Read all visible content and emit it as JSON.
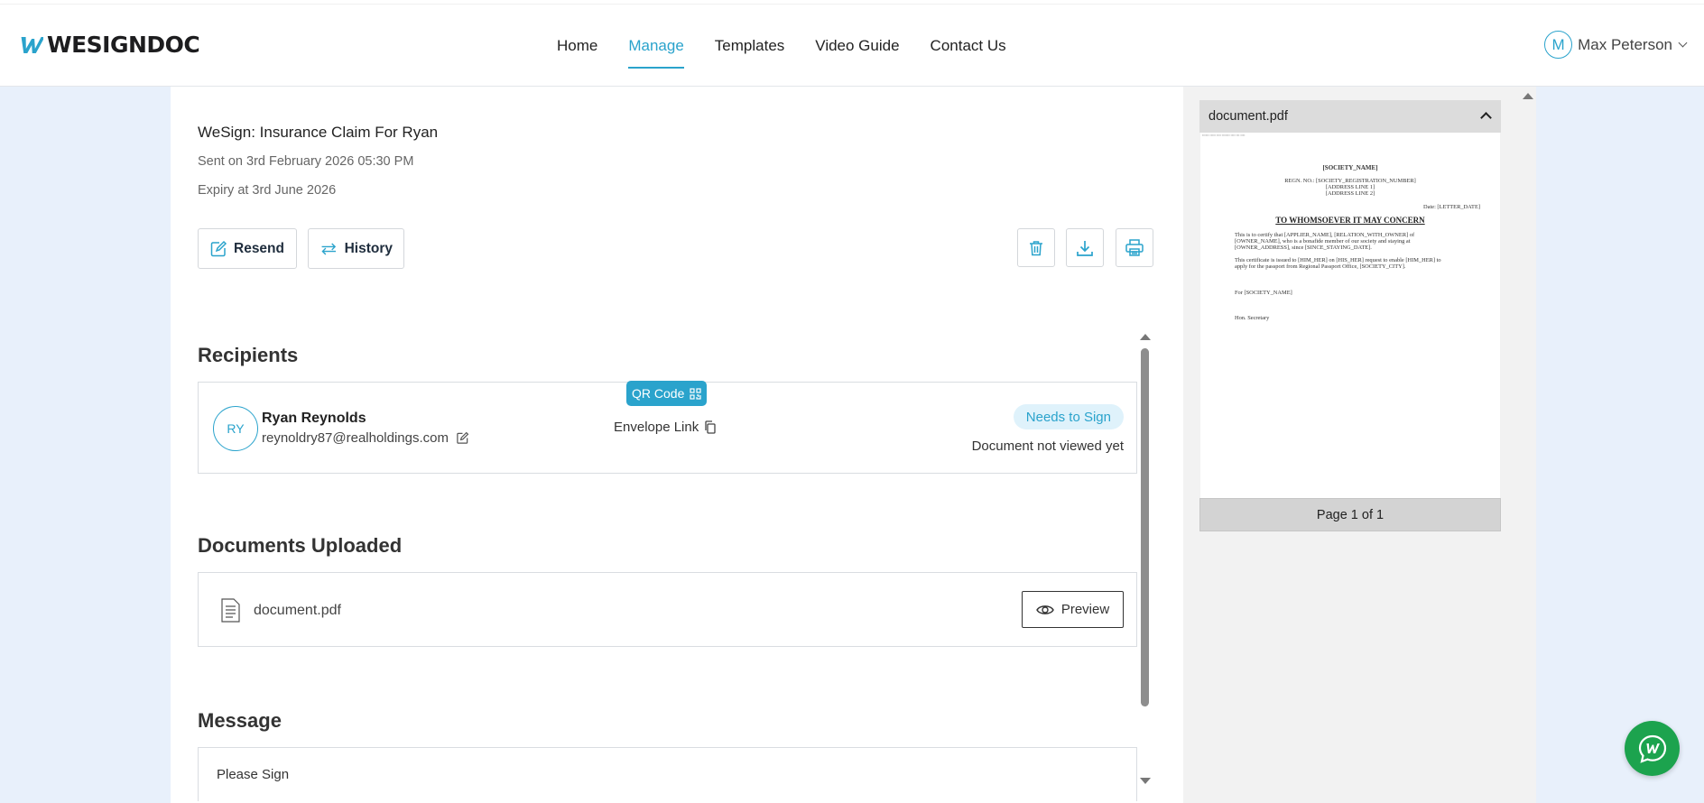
{
  "brand": {
    "logo_text": "WESIGNDOC",
    "accent": "#2aa3cc"
  },
  "nav": {
    "items": [
      {
        "label": "Home"
      },
      {
        "label": "Manage",
        "active": true
      },
      {
        "label": "Templates"
      },
      {
        "label": "Video Guide"
      },
      {
        "label": "Contact Us"
      }
    ]
  },
  "user": {
    "initial": "M",
    "name": "Max Peterson"
  },
  "envelope": {
    "title": "WeSign: Insurance Claim For Ryan",
    "sent": "Sent on 3rd February 2026 05:30 PM",
    "expiry": "Expiry at 3rd June 2026"
  },
  "actions": {
    "resend_label": "Resend",
    "history_label": "History"
  },
  "recipients": {
    "heading": "Recipients",
    "items": [
      {
        "initials": "RY",
        "name": "Ryan Reynolds",
        "email": "reynoldry87@realholdings.com",
        "qr_label": "QR Code",
        "envelope_link_label": "Envelope Link",
        "status": "Needs to Sign",
        "view_status": "Document not viewed yet"
      }
    ]
  },
  "documents": {
    "heading": "Documents Uploaded",
    "items": [
      {
        "name": "document.pdf",
        "preview_label": "Preview"
      }
    ]
  },
  "message": {
    "heading": "Message",
    "text": "Please Sign"
  },
  "pdf_preview": {
    "file_name": "document.pdf",
    "page_indicator": "Page 1 of 1",
    "content": {
      "society_name": "[SOCIETY_NAME]",
      "reg_line": "REGN. NO.: [SOCIETY_REGISTRATION_NUMBER]",
      "address1": "[ADDRESS LINE 1]",
      "address2": "[ADDRESS LINE 2]",
      "date_line": "Date: [LETTER_DATE]",
      "heading": "TO WHOMSOEVER IT MAY CONCERN",
      "para1_l1": "This is to certify that [APPLIER_NAME], [RELATION_WITH_OWNER] of",
      "para1_l2": "[OWNER_NAME], who is a bonafide member of our society and staying at",
      "para1_l3": "[OWNER_ADDRESS], since [SINCE_STAYING_DATE].",
      "para2_l1": "This certificate is issued to [HIM_HER] on [HIS_HER] request to enable [HIM_HER] to",
      "para2_l2": "apply for the passport from Regional Passport Office, [SOCIETY_CITY].",
      "for_line": "For [SOCIETY_NAME]",
      "sign_line": "Hon. Secretary"
    }
  }
}
